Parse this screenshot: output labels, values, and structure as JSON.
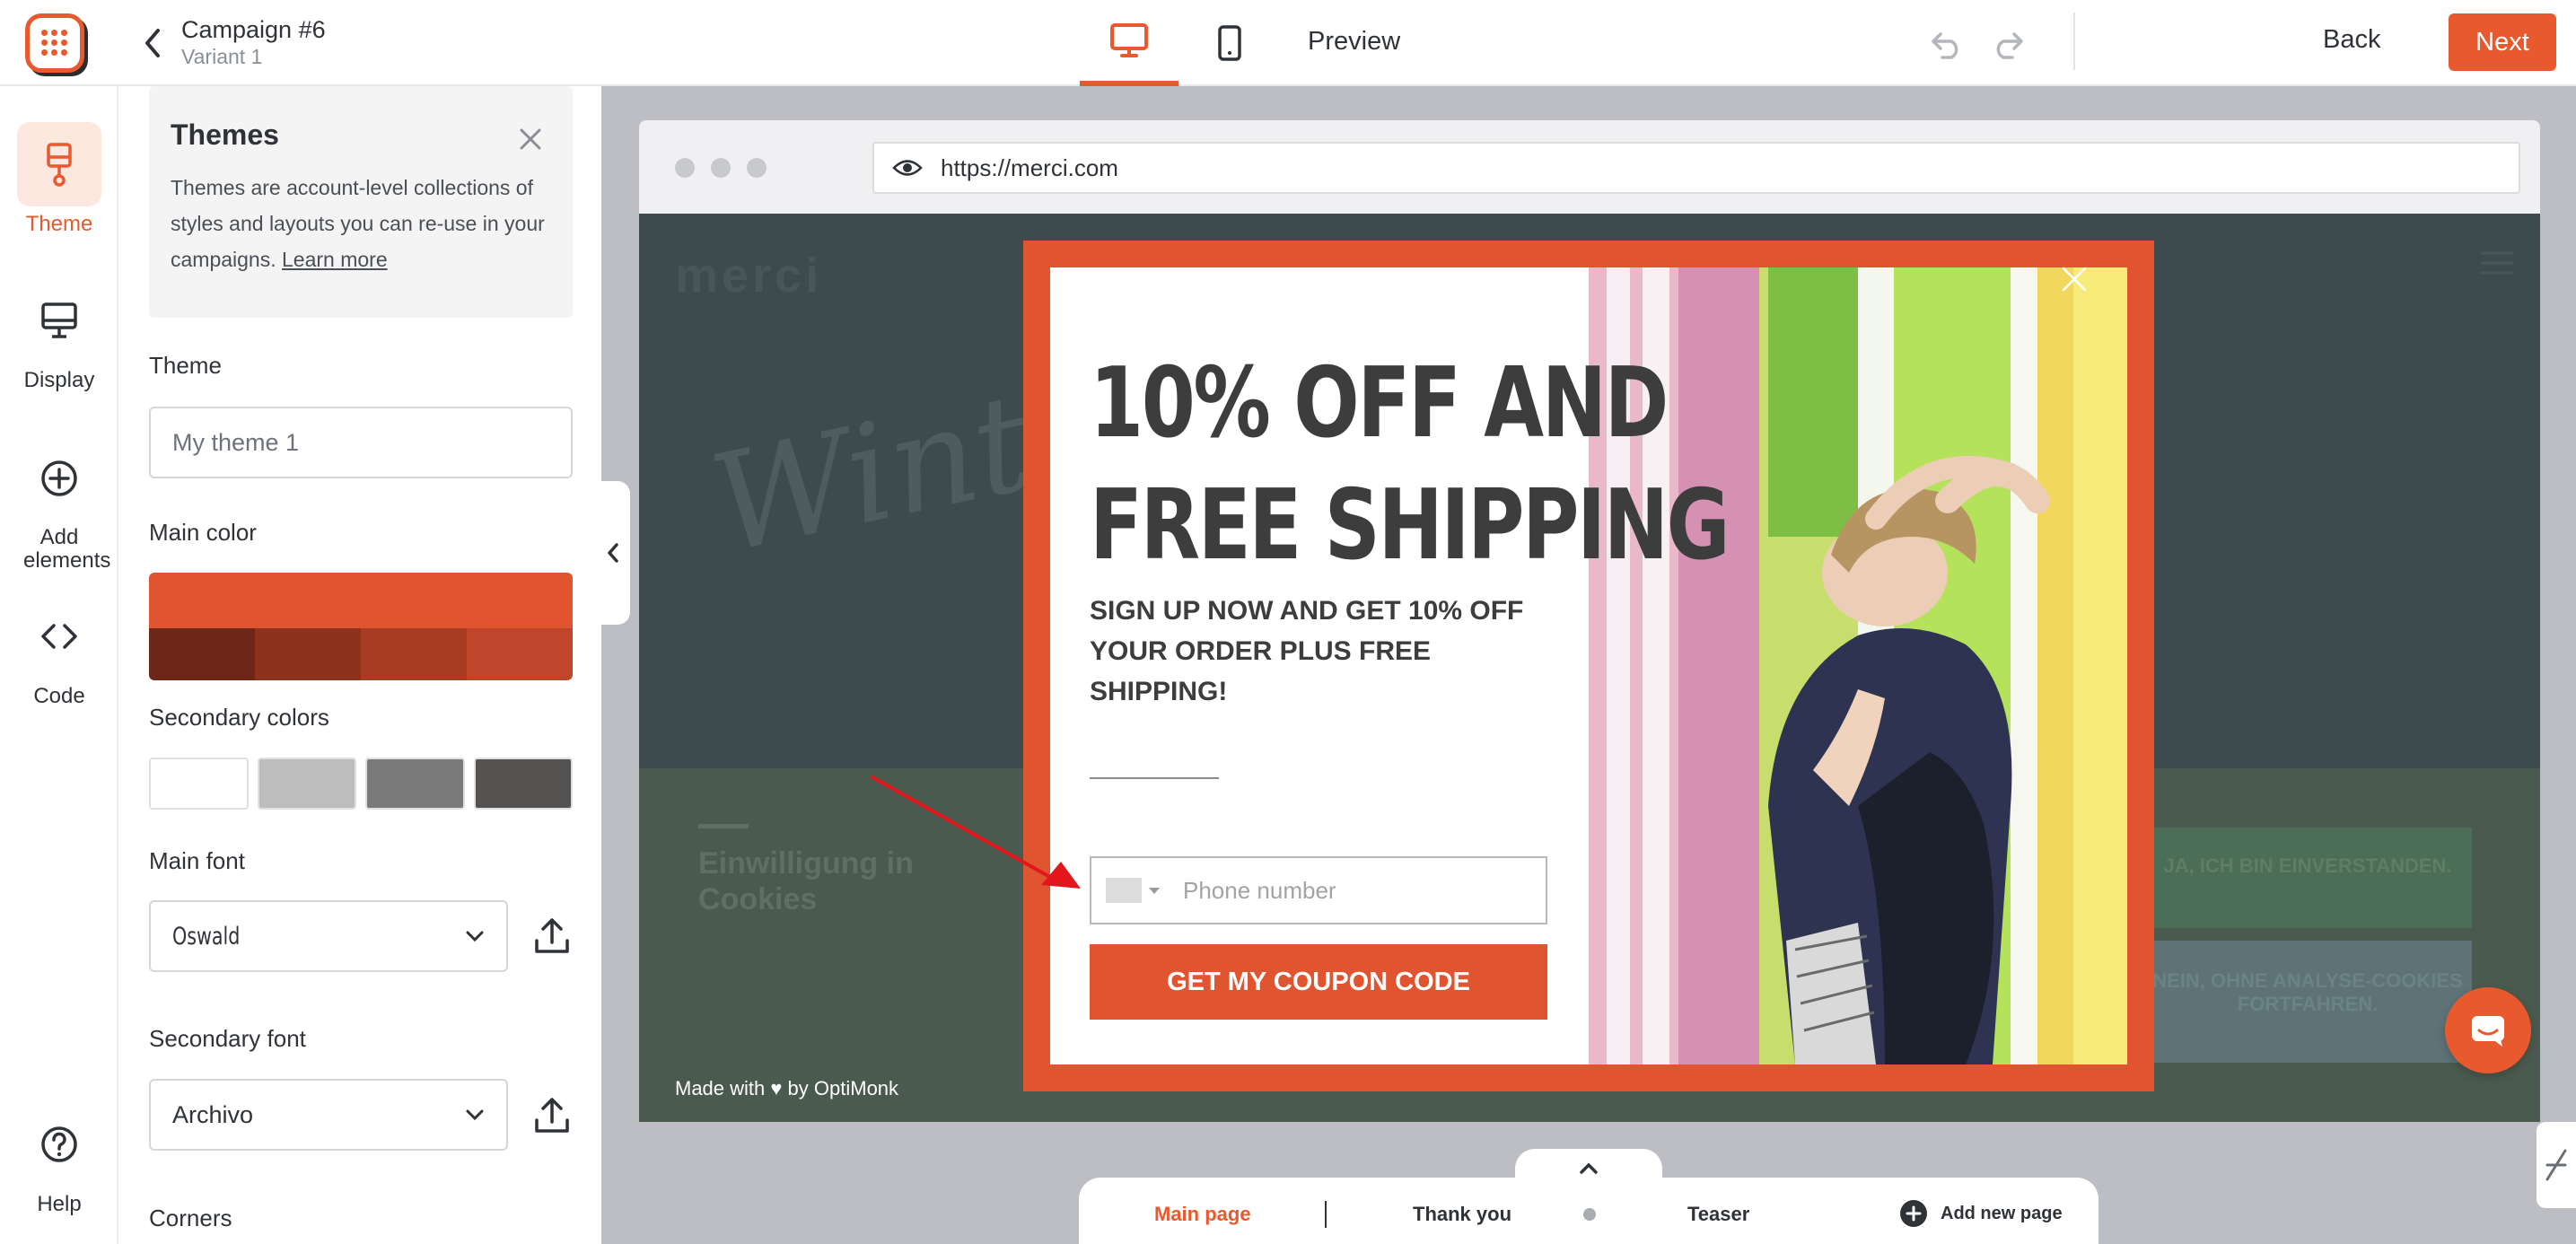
{
  "header": {
    "campaign_title": "Campaign #6",
    "variant": "Variant 1",
    "preview_label": "Preview",
    "back_label": "Back",
    "next_label": "Next",
    "active_device": "desktop",
    "accent_color": "#e8592e"
  },
  "rail": {
    "items": [
      {
        "label": "Theme",
        "icon": "paint-brush-icon",
        "active": true
      },
      {
        "label": "Display",
        "icon": "monitor-icon"
      },
      {
        "label": "Add elements",
        "icon": "plus-circle-icon"
      },
      {
        "label": "Code",
        "icon": "code-icon"
      },
      {
        "label": "Help",
        "icon": "help-icon"
      }
    ]
  },
  "themes_panel": {
    "title": "Themes",
    "description": "Themes are account-level collections of styles and layouts you can re-use in your campaigns.",
    "learn_more": "Learn more",
    "theme_label": "Theme",
    "theme_name": "My theme 1",
    "main_color_label": "Main color",
    "main_color": "#e05530",
    "main_color_shades": [
      "#6e2716",
      "#8c311b",
      "#a83c22",
      "#bf462a"
    ],
    "secondary_colors_label": "Secondary colors",
    "secondary_colors": [
      "#ffffff",
      "#bdbdbd",
      "#7a7a7a",
      "#555252"
    ],
    "main_font_label": "Main font",
    "main_font": "Oswald",
    "secondary_font_label": "Secondary font",
    "secondary_font": "Archivo",
    "corners_label": "Corners"
  },
  "browser": {
    "url": "https://merci.com"
  },
  "website_bg": {
    "brand": "merci",
    "hero_text": "Winter Chocola",
    "consent_title": "Einwilligung in Cookies",
    "accept_button": "JA, ICH BIN EINVERSTANDEN.",
    "decline_button": "NEIN, OHNE ANALYSE-COOKIES FORTFAHREN."
  },
  "popup": {
    "headline_line1": "10% OFF AND",
    "headline_line2": "FREE SHIPPING",
    "subheadline": "SIGN UP NOW AND GET 10% OFF YOUR ORDER PLUS FREE SHIPPING!",
    "phone_placeholder": "Phone number",
    "cta_label": "GET MY COUPON CODE",
    "frame_color": "#e05530",
    "made_with": "Made with ♥ by OptiMonk"
  },
  "pages": {
    "items": [
      {
        "label": "Main page",
        "active": true
      },
      {
        "label": "Thank you"
      },
      {
        "label": "Teaser"
      }
    ],
    "add_label": "Add new page"
  }
}
